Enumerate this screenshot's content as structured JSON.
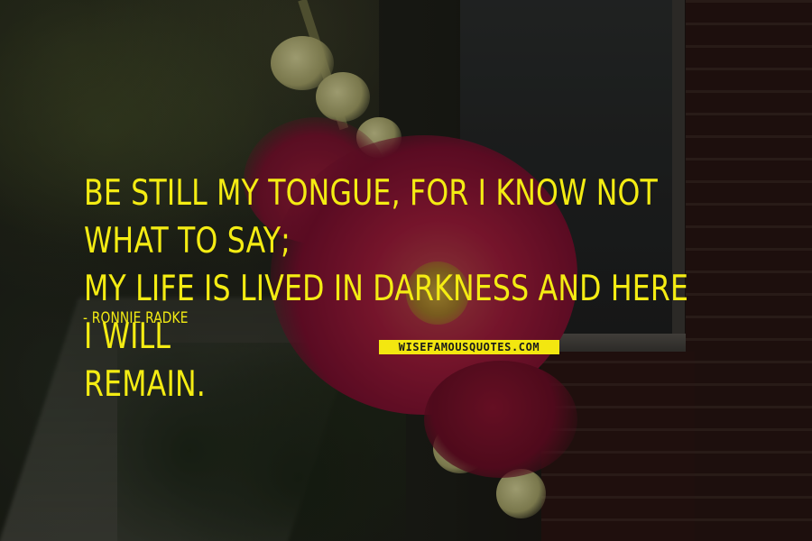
{
  "quote": {
    "text": "BE STILL MY TONGUE, FOR I KNOW NOT WHAT TO SAY;\nMY LIFE IS LIVED IN DARKNESS AND HERE I WILL\nREMAIN.",
    "attribution": "- RONNIE RADKE"
  },
  "watermark": {
    "text": "WISEFAMOUSQUOTES.COM"
  },
  "colors": {
    "quote_text": "#f4ec13",
    "watermark_bg": "#f3e710",
    "flower": "#a31d3c"
  }
}
